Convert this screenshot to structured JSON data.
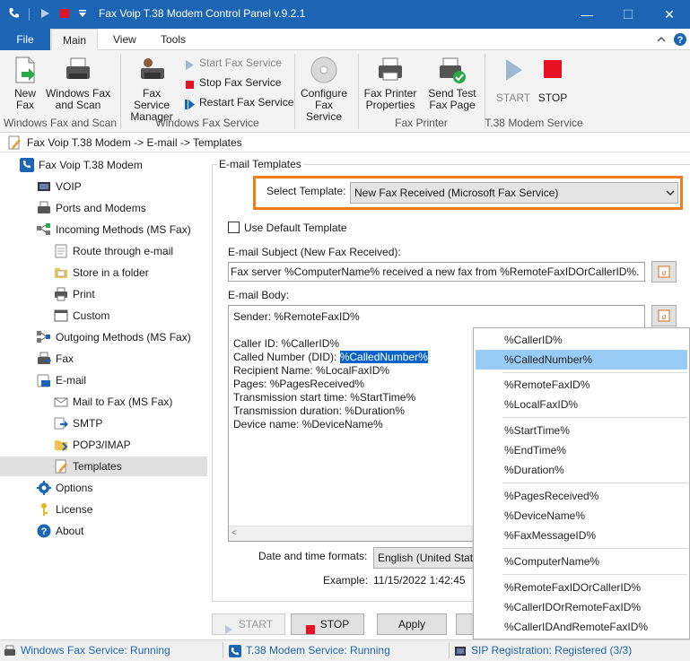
{
  "window": {
    "title": "Fax Voip T.38 Modem Control Panel v.9.2.1",
    "minimize": "—",
    "maximize": "☐",
    "close": "✕"
  },
  "ribbon_tabs": [
    "File",
    "Main",
    "View",
    "Tools"
  ],
  "ribbon": {
    "new_fax": "New Fax",
    "windows_fax_scan": "Windows Fax and Scan",
    "fax_service_manager": "Fax Service Manager",
    "start_fax_service": "Start Fax Service",
    "stop_fax_service": "Stop Fax Service",
    "restart_fax_service": "Restart Fax Service",
    "configure_fax_service": "Configure Fax Service",
    "fax_printer_properties": "Fax Printer Properties",
    "send_test_fax_page": "Send Test Fax Page",
    "start": "START",
    "stop": "STOP",
    "groups": {
      "windows_fax": "Windows Fax and Scan",
      "windows_fax_service": "Windows Fax Service",
      "fax_printer": "Fax Printer",
      "modem_service": "T.38 Modem Service"
    }
  },
  "breadcrumb": "Fax Voip T.38 Modem -> E-mail -> Templates",
  "tree": {
    "root": "Fax Voip T.38 Modem",
    "voip": "VOIP",
    "ports": "Ports and Modems",
    "incoming": "Incoming Methods (MS Fax)",
    "route_email": "Route through e-mail",
    "store_folder": "Store in a folder",
    "print": "Print",
    "custom": "Custom",
    "outgoing": "Outgoing Methods (MS Fax)",
    "fax": "Fax",
    "email": "E-mail",
    "mail_to_fax": "Mail to Fax (MS Fax)",
    "smtp": "SMTP",
    "pop3": "POP3/IMAP",
    "templates": "Templates",
    "options": "Options",
    "license": "License",
    "about": "About"
  },
  "main": {
    "group_title": "E-mail Templates",
    "select_template_label": "Select Template:",
    "select_template_value": "New Fax Received (Microsoft Fax Service)",
    "use_default_label": "Use Default Template",
    "subject_label": "E-mail Subject (New Fax Received):",
    "subject_value": "Fax server %ComputerName% received a new fax from %RemoteFaxIDOrCallerID%.",
    "body_label": "E-mail Body:",
    "body": {
      "line1": "Sender: %RemoteFaxID%",
      "line2": "Caller ID: %CallerID%",
      "line3_prefix": "Called Number (DID): ",
      "line3_highlight": "%CalledNumber%",
      "line4": "Recipient Name: %LocalFaxID%",
      "line5": "Pages: %PagesReceived%",
      "line6": "Transmission start time: %StartTime%",
      "line7": "Transmission duration: %Duration%",
      "line8": "Device name: %DeviceName%"
    },
    "date_formats_label": "Date and time formats:",
    "date_formats_value": "English (United State",
    "example_label": "Example:",
    "example_value": "11/15/2022 1:42:45",
    "start_btn": "START",
    "stop_btn": "STOP",
    "apply_btn": "Apply"
  },
  "popup_menu": [
    "%CallerID%",
    "%CalledNumber%",
    "%RemoteFaxID%",
    "%LocalFaxID%",
    "%StartTime%",
    "%EndTime%",
    "%Duration%",
    "%PagesReceived%",
    "%DeviceName%",
    "%FaxMessageID%",
    "%ComputerName%",
    "%RemoteFaxIDOrCallerID%",
    "%CallerIDOrRemoteFaxID%",
    "%CallerIDAndRemoteFaxID%"
  ],
  "statusbar": {
    "windows_fax": "Windows Fax Service: Running",
    "t38": "T.38 Modem Service: Running",
    "sip": "SIP Registration: Registered (3/3)"
  },
  "colors": {
    "titlebar": "#1b65b4",
    "highlight_orange": "#f07d1a",
    "menu_hover": "#99ccf5",
    "stop_red": "#e81123"
  }
}
